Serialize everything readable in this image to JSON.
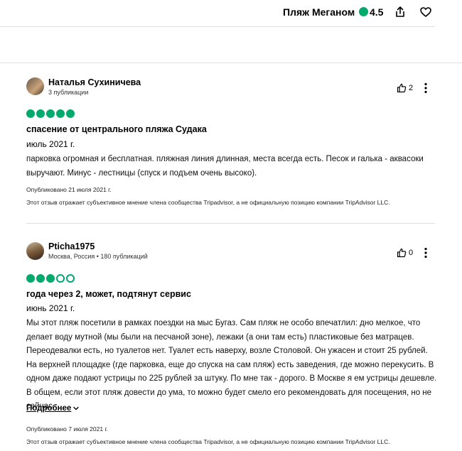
{
  "header": {
    "title": "Пляж Меганом",
    "rating": "4.5",
    "icons": {
      "share": "share-icon",
      "save": "heart-icon"
    },
    "accent": "#00aa6c"
  },
  "reviews": [
    {
      "author": "Наталья Сухиничева",
      "meta": "3 публикации",
      "helpful_votes": "2",
      "rating": 5,
      "title": "спасение от центрального пляжа Судака",
      "date_of_visit": "июль 2021 г.",
      "body": "парковка огромная и бесплатная. пляжная линия длинная, места всегда есть. Песок и галька - аквасоки выручают. Минус - лестницы (спуск и подъем очень высоко).",
      "published": "Опубликовано 21 июля 2021 г.",
      "disclaimer": "Этот отзыв отражает субъективное мнение члена сообщества Tripadvisor, а не официальную позицию компании TripAdvisor LLC."
    },
    {
      "author": "Pticha1975",
      "meta": "Москва, Россия • 180 публикаций",
      "helpful_votes": "0",
      "rating": 3,
      "title": "года через 2, может, подтянут сервис",
      "date_of_visit": "июнь 2021 г.",
      "body": "Мы этот пляж посетили в рамках поездки на мыс Бугаз. Сам пляж не особо впечатлил: дно мелкое, что делает воду мутной (мы были на песчаной зоне), лежаки (а они там есть) пластиковые без матрацев. Переодевалки есть, но туалетов нет. Туалет есть наверху, возле Столовой. Он ужасен и стоит 25 рублей. На верхней площадке (где парковка, еще до спуска на сам пляж) есть заведения, где можно перекусить. В одном даже подают устрицы по 225 рублей за штуку. По мне так - дорого. В Москве я ем устрицы дешевле. В общем, если этот пляж довести до ума, то можно будет смело его рекомендовать для посещения, но не сейчас.",
      "read_more": "Подробнее",
      "published": "Опубликовано 7 июля 2021 г.",
      "disclaimer": "Этот отзыв отражает субъективное мнение члена сообщества Tripadvisor, а не официальную позицию компании TripAdvisor LLC."
    }
  ]
}
